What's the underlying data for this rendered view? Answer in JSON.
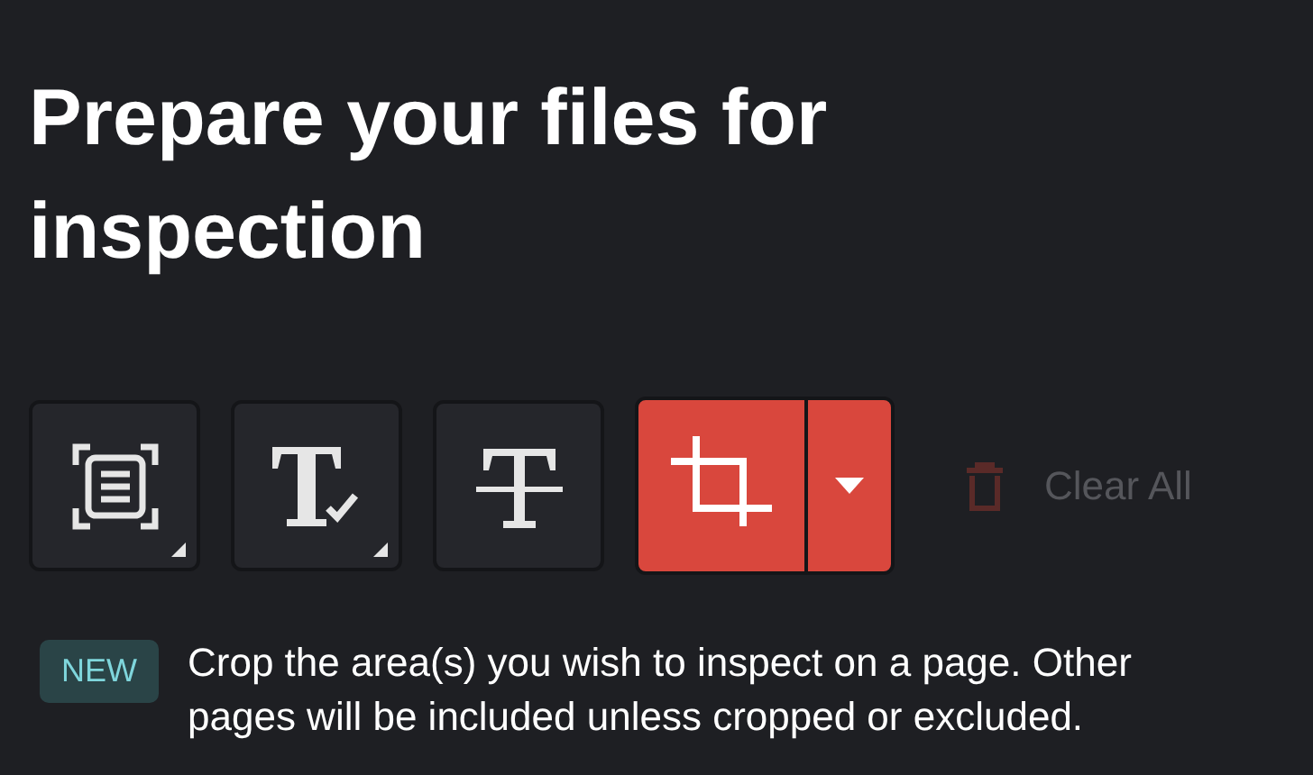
{
  "title": "Prepare your files for inspection",
  "tools": [
    {
      "kind": "page-region",
      "selected": false,
      "menu": true
    },
    {
      "kind": "text-check",
      "selected": false,
      "menu": true
    },
    {
      "kind": "strikethrough",
      "selected": false,
      "menu": false
    },
    {
      "kind": "crop",
      "selected": true,
      "split": true
    }
  ],
  "clear_all": {
    "label": "Clear All",
    "disabled": true
  },
  "notice": {
    "badge": "NEW",
    "text": "Crop the area(s) you wish to inspect on a page. Other pages will be included unless cropped or excluded."
  }
}
